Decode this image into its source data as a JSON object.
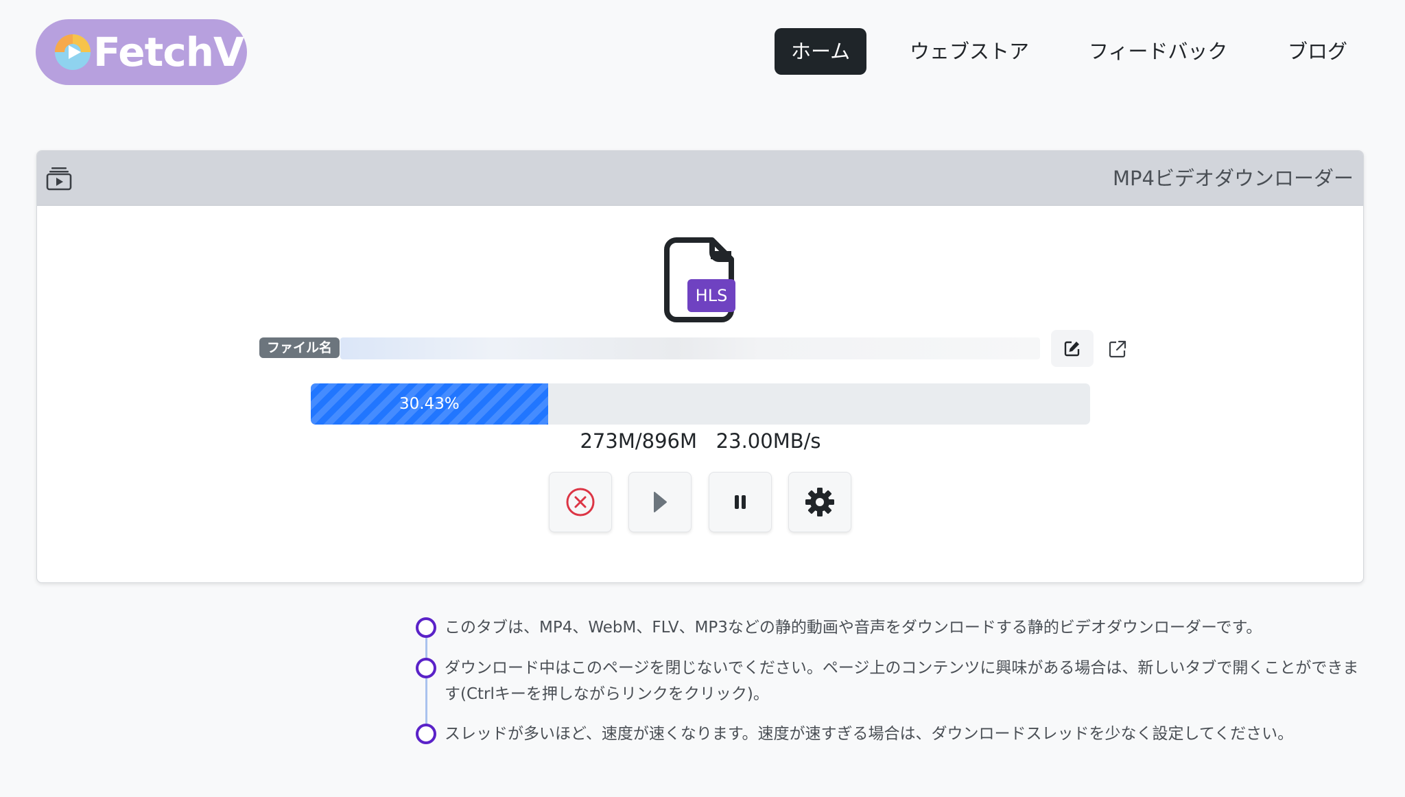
{
  "brand": {
    "name": "FetchV",
    "logo_color": "#b7a0de"
  },
  "nav": {
    "items": [
      {
        "label": "ホーム",
        "active": true
      },
      {
        "label": "ウェブストア",
        "active": false
      },
      {
        "label": "フィードバック",
        "active": false
      },
      {
        "label": "ブログ",
        "active": false
      }
    ]
  },
  "card": {
    "header_icon": "playlist-play-icon",
    "title": "MP4ビデオダウンローダー",
    "file": {
      "icon": "file-icon",
      "type_badge": "HLS",
      "badge_color": "#6f42c1"
    },
    "filename": {
      "label": "ファイル名",
      "value": ""
    },
    "edit_icon": "edit-icon",
    "open_icon": "external-link-icon",
    "progress": {
      "percent": 30.43,
      "label": "30.43%",
      "color": "#2176ff"
    },
    "stats": {
      "size": "273M/896M",
      "speed": "23.00MB/s"
    },
    "controls": [
      {
        "name": "cancel",
        "icon": "cancel-circle-icon",
        "color": "#dc3545"
      },
      {
        "name": "play",
        "icon": "play-icon",
        "color": "#6c757d"
      },
      {
        "name": "pause",
        "icon": "pause-icon",
        "color": "#212529"
      },
      {
        "name": "settings",
        "icon": "gear-icon",
        "color": "#212529"
      }
    ]
  },
  "notes": [
    {
      "text": "このタブは、MP4、WebM、FLV、MP3などの静的動画や音声をダウンロードする静的ビデオダウンローダーです。"
    },
    {
      "text": "ダウンロード中はこのページを閉じないでください。ページ上のコンテンツに興味がある場合は、新しいタブで開くことができます(Ctrlキーを押しながらリンクをクリック)。"
    },
    {
      "text": "スレッドが多いほど、速度が速くなります。速度が速すぎる場合は、ダウンロードスレッドを少なく設定してください。"
    }
  ]
}
